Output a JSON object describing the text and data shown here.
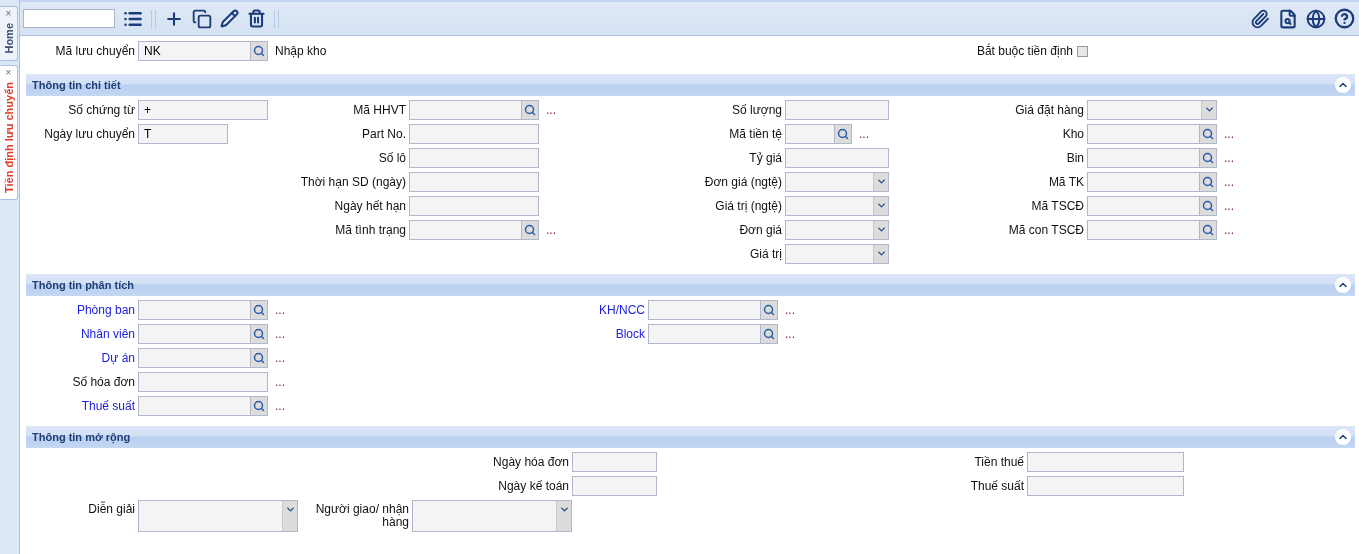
{
  "side_tabs": [
    {
      "label": "Home",
      "close": "×",
      "selected": false
    },
    {
      "label": "Tiền định lưu chuyển",
      "close": "×",
      "selected": true
    }
  ],
  "top": {
    "field": {
      "label": "Mã lưu chuyển",
      "kind": "lookup",
      "value": "NK",
      "note": "Nhập kho"
    },
    "required": {
      "label": "Bắt buộc tiền định",
      "checked": false
    }
  },
  "sections": [
    {
      "title": "Thông tin chi tiết",
      "expanded": true,
      "rows": [
        [
          [
            {
              "label": "Số chứng từ",
              "kind": "text",
              "value": "+"
            },
            {
              "label": "Ngày lưu chuyển",
              "kind": "text",
              "value": "T"
            }
          ],
          [
            {
              "label": "Mã HHVT",
              "kind": "lookup",
              "more": "..."
            },
            {
              "label": "Part No.",
              "kind": "text"
            },
            {
              "label": "Số lô",
              "kind": "text"
            },
            {
              "label": "Thời hạn SD (ngày)",
              "kind": "text"
            },
            {
              "label": "Ngày hết hạn",
              "kind": "text"
            },
            {
              "label": "Mã tình trạng",
              "kind": "lookup",
              "more": "..."
            }
          ],
          [
            {
              "label": "Số lượng",
              "kind": "text"
            },
            {
              "label": "Mã tiền tệ",
              "kind": "lookup",
              "more": "..."
            },
            {
              "label": "Tỷ giá",
              "kind": "text"
            },
            {
              "label": "Đơn giá (ngtệ)",
              "kind": "select"
            },
            {
              "label": "Giá trị (ngtệ)",
              "kind": "select"
            },
            {
              "label": "Đơn giá",
              "kind": "select"
            },
            {
              "label": "Giá trị",
              "kind": "select"
            }
          ],
          [
            {
              "label": "Giá đặt hàng",
              "kind": "select"
            },
            {
              "label": "Kho",
              "kind": "lookup",
              "more": "..."
            },
            {
              "label": "Bin",
              "kind": "lookup",
              "more": "..."
            },
            {
              "label": "Mã TK",
              "kind": "lookup",
              "more": "..."
            },
            {
              "label": "Mã TSCĐ",
              "kind": "lookup",
              "more": "..."
            },
            {
              "label": "Mã con TSCĐ",
              "kind": "lookup",
              "more": "..."
            }
          ]
        ]
      ]
    },
    {
      "title": "Thông tin phân tích",
      "expanded": true,
      "rows": [
        [
          [
            {
              "label": "Phòng ban",
              "kind": "lookup",
              "more": "...",
              "linked": true
            },
            {
              "label": "Nhân viên",
              "kind": "lookup",
              "more": "...",
              "linked": true
            },
            {
              "label": "Dự án",
              "kind": "lookup",
              "more": "...",
              "linked": true
            },
            {
              "label": "Số hóa đơn",
              "kind": "text",
              "more": "..."
            },
            {
              "label": "Thuế suất",
              "kind": "lookup",
              "more": "...",
              "linked": true
            }
          ],
          [
            {
              "label": "KH/NCC",
              "kind": "lookup",
              "more": "...",
              "linked": true
            },
            {
              "label": "Block",
              "kind": "lookup",
              "more": "...",
              "linked": true
            }
          ]
        ]
      ]
    },
    {
      "title": "Thông tin mở rộng",
      "expanded": true,
      "rows": [
        [
          [
            {
              "label": "Ngày hóa đơn",
              "kind": "text"
            },
            {
              "label": "Ngày kế toán",
              "kind": "text"
            }
          ],
          [
            {
              "label": "Tiền thuế",
              "kind": "text"
            },
            {
              "label": "Thuế suất",
              "kind": "text"
            }
          ]
        ],
        [
          [
            {
              "label": "Diễn giải",
              "kind": "memo"
            }
          ],
          [
            {
              "label": "Người giao/ nhận hàng",
              "kind": "memo"
            }
          ]
        ]
      ]
    }
  ]
}
